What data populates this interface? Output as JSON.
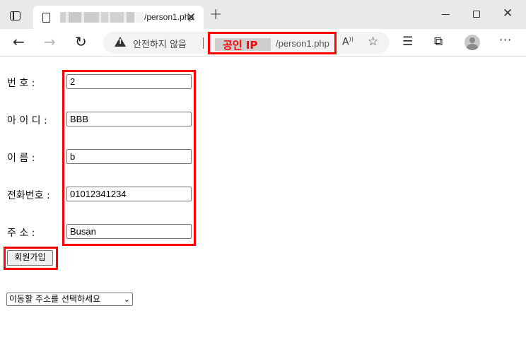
{
  "browser": {
    "tab_title": "/person1.php",
    "address": {
      "security_label": "안전하지 않음",
      "host_label": "공인 IP",
      "path": "/person1.php"
    },
    "icons": {
      "tab_list": "tab-list-icon",
      "favicon": "page-icon",
      "tab_close": "close-icon",
      "new_tab": "plus-icon",
      "back": "arrow-left-icon",
      "forward": "arrow-right-icon",
      "reload": "refresh-icon",
      "warning": "warning-icon",
      "read_aloud": "read-aloud-icon",
      "add_favorite": "star-plus-icon",
      "favorites": "favorites-icon",
      "collections": "collections-icon",
      "profile": "profile-icon",
      "more": "more-icon"
    }
  },
  "form": {
    "fields": [
      {
        "label": "번 호 :",
        "value": "2"
      },
      {
        "label": "아 이 디 :",
        "value": "BBB"
      },
      {
        "label": "이 름 :",
        "value": "b"
      },
      {
        "label": "전화번호 :",
        "value": "01012341234"
      },
      {
        "label": "주 소 :",
        "value": "Busan"
      }
    ],
    "submit_label": "회원가입",
    "select_value": "이동할 주소를 선택하세요"
  },
  "colors": {
    "highlight": "#ff0000",
    "tabbar_bg": "#e9e9e9",
    "addressbar_bg": "#f3f3f3"
  }
}
